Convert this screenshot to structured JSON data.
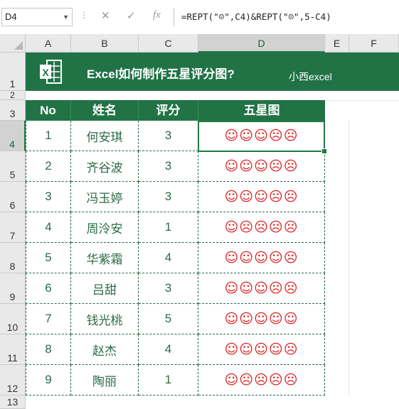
{
  "formula_bar": {
    "name_box": "D4",
    "cancel_glyph": "✕",
    "enter_glyph": "✓",
    "fx_label": "fx",
    "formula": "=REPT(\"☺\",C4)&REPT(\"☹\",5-C4)"
  },
  "columns": [
    "A",
    "B",
    "C",
    "D",
    "E",
    "F"
  ],
  "rows": [
    "1",
    "2",
    "3",
    "4",
    "5",
    "6",
    "7",
    "8",
    "9",
    "10",
    "11",
    "12",
    "13"
  ],
  "banner": {
    "title": "Excel如何制作五星评分图?",
    "subtitle": "小西excel",
    "icon": "excel-logo-icon",
    "color": "#217346"
  },
  "table": {
    "headers": [
      "No",
      "姓名",
      "评分",
      "五星图"
    ],
    "rows": [
      {
        "no": "1",
        "name": "何安琪",
        "score": "3",
        "stars": "☺☺☺☹☹"
      },
      {
        "no": "2",
        "name": "齐谷波",
        "score": "3",
        "stars": "☺☺☺☹☹"
      },
      {
        "no": "3",
        "name": "冯玉婷",
        "score": "3",
        "stars": "☺☺☺☹☹"
      },
      {
        "no": "4",
        "name": "周泠安",
        "score": "1",
        "stars": "☺☹☹☹☹"
      },
      {
        "no": "5",
        "name": "华紫霜",
        "score": "4",
        "stars": "☺☺☺☺☹"
      },
      {
        "no": "6",
        "name": "吕甜",
        "score": "3",
        "stars": "☺☺☺☹☹"
      },
      {
        "no": "7",
        "name": "钱光桃",
        "score": "5",
        "stars": "☺☺☺☺☺"
      },
      {
        "no": "8",
        "name": "赵杰",
        "score": "4",
        "stars": "☺☺☺☺☹"
      },
      {
        "no": "9",
        "name": "陶丽",
        "score": "1",
        "stars": "☺☹☹☹☹"
      }
    ]
  },
  "colors": {
    "accent": "#217346",
    "face": "#e02020",
    "text": "#2d6a48"
  }
}
